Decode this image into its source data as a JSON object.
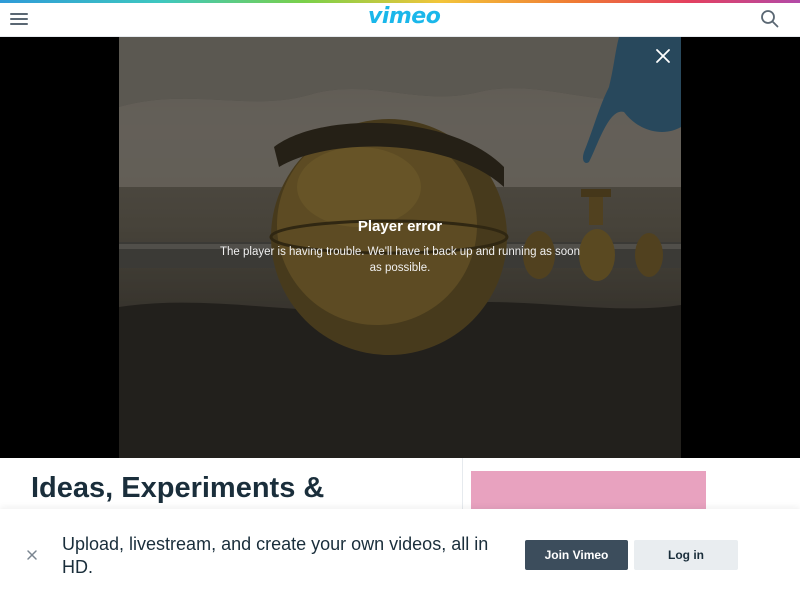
{
  "header": {
    "logo_text": "vimeo",
    "menu_icon": "hamburger-menu-icon",
    "search_icon": "search-icon",
    "accent_color": "#1ab7ea"
  },
  "player": {
    "error_title": "Player error",
    "error_message": "The player is having trouble. We'll have it back up and running as soon as possible.",
    "close_icon": "close-icon"
  },
  "video": {
    "title": "Ideas, Experiments &"
  },
  "signup_banner": {
    "message": "Upload, livestream, and create your own videos, all in HD.",
    "join_label": "Join Vimeo",
    "login_label": "Log in",
    "close_icon": "close-icon"
  }
}
